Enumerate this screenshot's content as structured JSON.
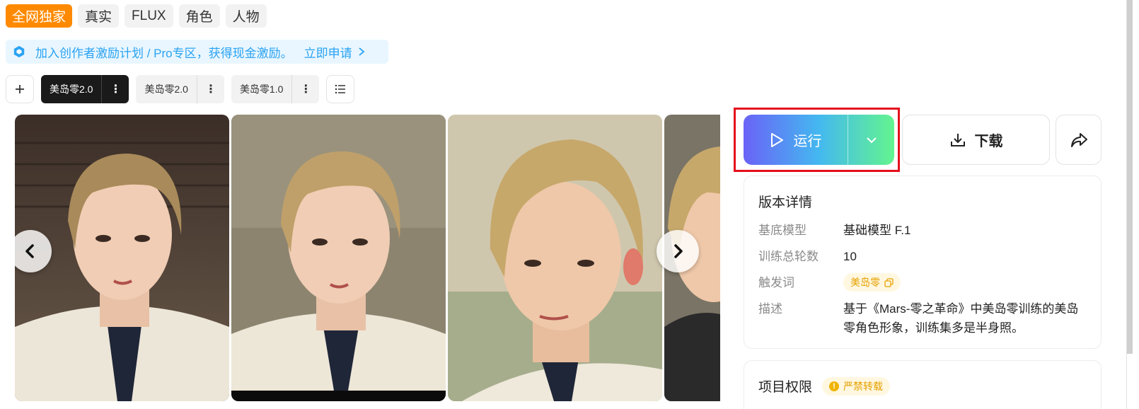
{
  "tags": [
    {
      "label": "全网独家",
      "exclusive": true
    },
    {
      "label": "真实"
    },
    {
      "label": "FLUX"
    },
    {
      "label": "角色"
    },
    {
      "label": "人物"
    }
  ],
  "banner": {
    "text": "加入创作者激励计划 / Pro专区，获得现金激励。",
    "apply": "立即申请",
    "icon": "hexagon-icon"
  },
  "versions": {
    "add_icon": "plus-icon",
    "list_icon": "list-icon",
    "tabs": [
      {
        "label": "美岛零2.0",
        "active": true
      },
      {
        "label": "美岛零2.0",
        "active": false
      },
      {
        "label": "美岛零1.0",
        "active": false
      }
    ]
  },
  "gallery": {
    "prev_icon": "chevron-left-icon",
    "next_icon": "chevron-right-icon"
  },
  "actions": {
    "run_label": "运行",
    "download_label": "下载",
    "share_icon": "share-icon",
    "accent_gradient": [
      "#6a63f7",
      "#44b8f0",
      "#63f48f"
    ],
    "highlight_color": "#e4101d"
  },
  "details": {
    "title": "版本详情",
    "rows": [
      {
        "key": "基底模型",
        "value": "基础模型 F.1"
      },
      {
        "key": "训练总轮数",
        "value": "10"
      },
      {
        "key": "触发词",
        "value": "美岛零"
      },
      {
        "key": "描述",
        "value": "基于《Mars-零之革命》中美岛零训练的美岛零角色形象，训练集多是半身照。"
      }
    ]
  },
  "rights": {
    "title": "项目权限",
    "badge": "严禁转载",
    "badge_icon": "!"
  }
}
